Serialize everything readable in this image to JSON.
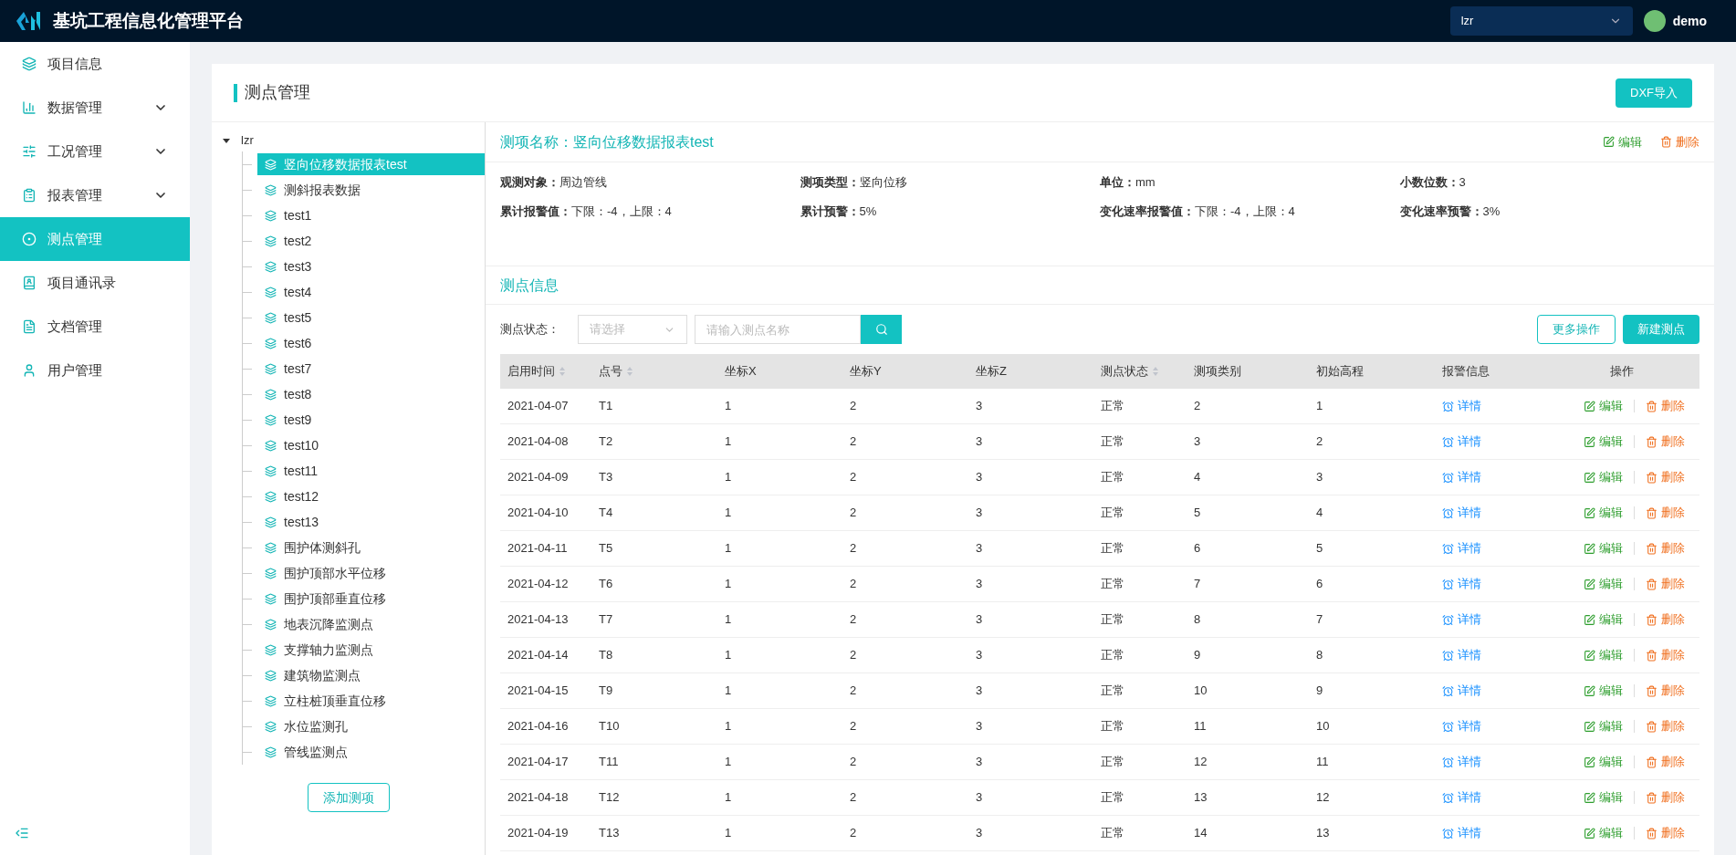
{
  "header": {
    "title": "基坑工程信息化管理平台",
    "project_select": {
      "value": "lzr"
    },
    "user": {
      "name": "demo"
    }
  },
  "sidebar": {
    "items": [
      {
        "label": "项目信息",
        "has_submenu": false,
        "selected": false
      },
      {
        "label": "数据管理",
        "has_submenu": true,
        "selected": false
      },
      {
        "label": "工况管理",
        "has_submenu": true,
        "selected": false
      },
      {
        "label": "报表管理",
        "has_submenu": true,
        "selected": false
      },
      {
        "label": "测点管理",
        "has_submenu": false,
        "selected": true
      },
      {
        "label": "项目通讯录",
        "has_submenu": false,
        "selected": false
      },
      {
        "label": "文档管理",
        "has_submenu": false,
        "selected": false
      },
      {
        "label": "用户管理",
        "has_submenu": false,
        "selected": false
      }
    ]
  },
  "page": {
    "title": "测点管理",
    "import_button": "DXF导入"
  },
  "tree": {
    "root": {
      "label": "lzr",
      "expanded": true,
      "children": [
        {
          "label": "竖向位移数据报表test",
          "selected": true
        },
        {
          "label": "测斜报表数据",
          "selected": false
        },
        {
          "label": "test1",
          "selected": false
        },
        {
          "label": "test2",
          "selected": false
        },
        {
          "label": "test3",
          "selected": false
        },
        {
          "label": "test4",
          "selected": false
        },
        {
          "label": "test5",
          "selected": false
        },
        {
          "label": "test6",
          "selected": false
        },
        {
          "label": "test7",
          "selected": false
        },
        {
          "label": "test8",
          "selected": false
        },
        {
          "label": "test9",
          "selected": false
        },
        {
          "label": "test10",
          "selected": false
        },
        {
          "label": "test11",
          "selected": false
        },
        {
          "label": "test12",
          "selected": false
        },
        {
          "label": "test13",
          "selected": false
        },
        {
          "label": "围护体测斜孔",
          "selected": false
        },
        {
          "label": "围护顶部水平位移",
          "selected": false
        },
        {
          "label": "围护顶部垂直位移",
          "selected": false
        },
        {
          "label": "地表沉降监测点",
          "selected": false
        },
        {
          "label": "支撑轴力监测点",
          "selected": false
        },
        {
          "label": "建筑物监测点",
          "selected": false
        },
        {
          "label": "立柱桩顶垂直位移",
          "selected": false
        },
        {
          "label": "水位监测孔",
          "selected": false
        },
        {
          "label": "管线监测点",
          "selected": false
        }
      ]
    },
    "add_button": "添加测项"
  },
  "item_detail": {
    "title": "测项名称：竖向位移数据报表test",
    "edit": "编辑",
    "delete": "删除",
    "fields": [
      {
        "label": "观测对象：",
        "value": "周边管线"
      },
      {
        "label": "测项类型：",
        "value": "竖向位移"
      },
      {
        "label": "单位：",
        "value": "mm"
      },
      {
        "label": "小数位数：",
        "value": "3"
      },
      {
        "label": "累计报警值：",
        "value": "下限：-4，上限：4"
      },
      {
        "label": "累计预警：",
        "value": "5%"
      },
      {
        "label": "变化速率报警值：",
        "value": "下限：-4，上限：4"
      },
      {
        "label": "变化速率预警：",
        "value": "3%"
      }
    ]
  },
  "points": {
    "title": "测点信息",
    "status_label": "测点状态：",
    "status_select": {
      "placeholder": "请选择"
    },
    "search": {
      "placeholder": "请输入测点名称"
    },
    "more_button": "更多操作",
    "new_button": "新建测点",
    "table": {
      "columns": [
        {
          "label": "启用时间",
          "sortable": true
        },
        {
          "label": "点号",
          "sortable": true
        },
        {
          "label": "坐标X",
          "sortable": false
        },
        {
          "label": "坐标Y",
          "sortable": false
        },
        {
          "label": "坐标Z",
          "sortable": false
        },
        {
          "label": "测点状态",
          "sortable": true
        },
        {
          "label": "测项类别",
          "sortable": false
        },
        {
          "label": "初始高程",
          "sortable": false
        },
        {
          "label": "报警信息",
          "sortable": false
        },
        {
          "label": "操作",
          "sortable": false
        }
      ],
      "rows": [
        {
          "cells": [
            "2021-04-07",
            "T1",
            "1",
            "2",
            "3",
            "正常",
            "2",
            "1"
          ],
          "detail": "详情",
          "edit": "编辑",
          "delete": "删除"
        },
        {
          "cells": [
            "2021-04-08",
            "T2",
            "1",
            "2",
            "3",
            "正常",
            "3",
            "2"
          ],
          "detail": "详情",
          "edit": "编辑",
          "delete": "删除"
        },
        {
          "cells": [
            "2021-04-09",
            "T3",
            "1",
            "2",
            "3",
            "正常",
            "4",
            "3"
          ],
          "detail": "详情",
          "edit": "编辑",
          "delete": "删除"
        },
        {
          "cells": [
            "2021-04-10",
            "T4",
            "1",
            "2",
            "3",
            "正常",
            "5",
            "4"
          ],
          "detail": "详情",
          "edit": "编辑",
          "delete": "删除"
        },
        {
          "cells": [
            "2021-04-11",
            "T5",
            "1",
            "2",
            "3",
            "正常",
            "6",
            "5"
          ],
          "detail": "详情",
          "edit": "编辑",
          "delete": "删除"
        },
        {
          "cells": [
            "2021-04-12",
            "T6",
            "1",
            "2",
            "3",
            "正常",
            "7",
            "6"
          ],
          "detail": "详情",
          "edit": "编辑",
          "delete": "删除"
        },
        {
          "cells": [
            "2021-04-13",
            "T7",
            "1",
            "2",
            "3",
            "正常",
            "8",
            "7"
          ],
          "detail": "详情",
          "edit": "编辑",
          "delete": "删除"
        },
        {
          "cells": [
            "2021-04-14",
            "T8",
            "1",
            "2",
            "3",
            "正常",
            "9",
            "8"
          ],
          "detail": "详情",
          "edit": "编辑",
          "delete": "删除"
        },
        {
          "cells": [
            "2021-04-15",
            "T9",
            "1",
            "2",
            "3",
            "正常",
            "10",
            "9"
          ],
          "detail": "详情",
          "edit": "编辑",
          "delete": "删除"
        },
        {
          "cells": [
            "2021-04-16",
            "T10",
            "1",
            "2",
            "3",
            "正常",
            "11",
            "10"
          ],
          "detail": "详情",
          "edit": "编辑",
          "delete": "删除"
        },
        {
          "cells": [
            "2021-04-17",
            "T11",
            "1",
            "2",
            "3",
            "正常",
            "12",
            "11"
          ],
          "detail": "详情",
          "edit": "编辑",
          "delete": "删除"
        },
        {
          "cells": [
            "2021-04-18",
            "T12",
            "1",
            "2",
            "3",
            "正常",
            "13",
            "12"
          ],
          "detail": "详情",
          "edit": "编辑",
          "delete": "删除"
        },
        {
          "cells": [
            "2021-04-19",
            "T13",
            "1",
            "2",
            "3",
            "正常",
            "14",
            "13"
          ],
          "detail": "详情",
          "edit": "编辑",
          "delete": "删除"
        }
      ]
    }
  }
}
